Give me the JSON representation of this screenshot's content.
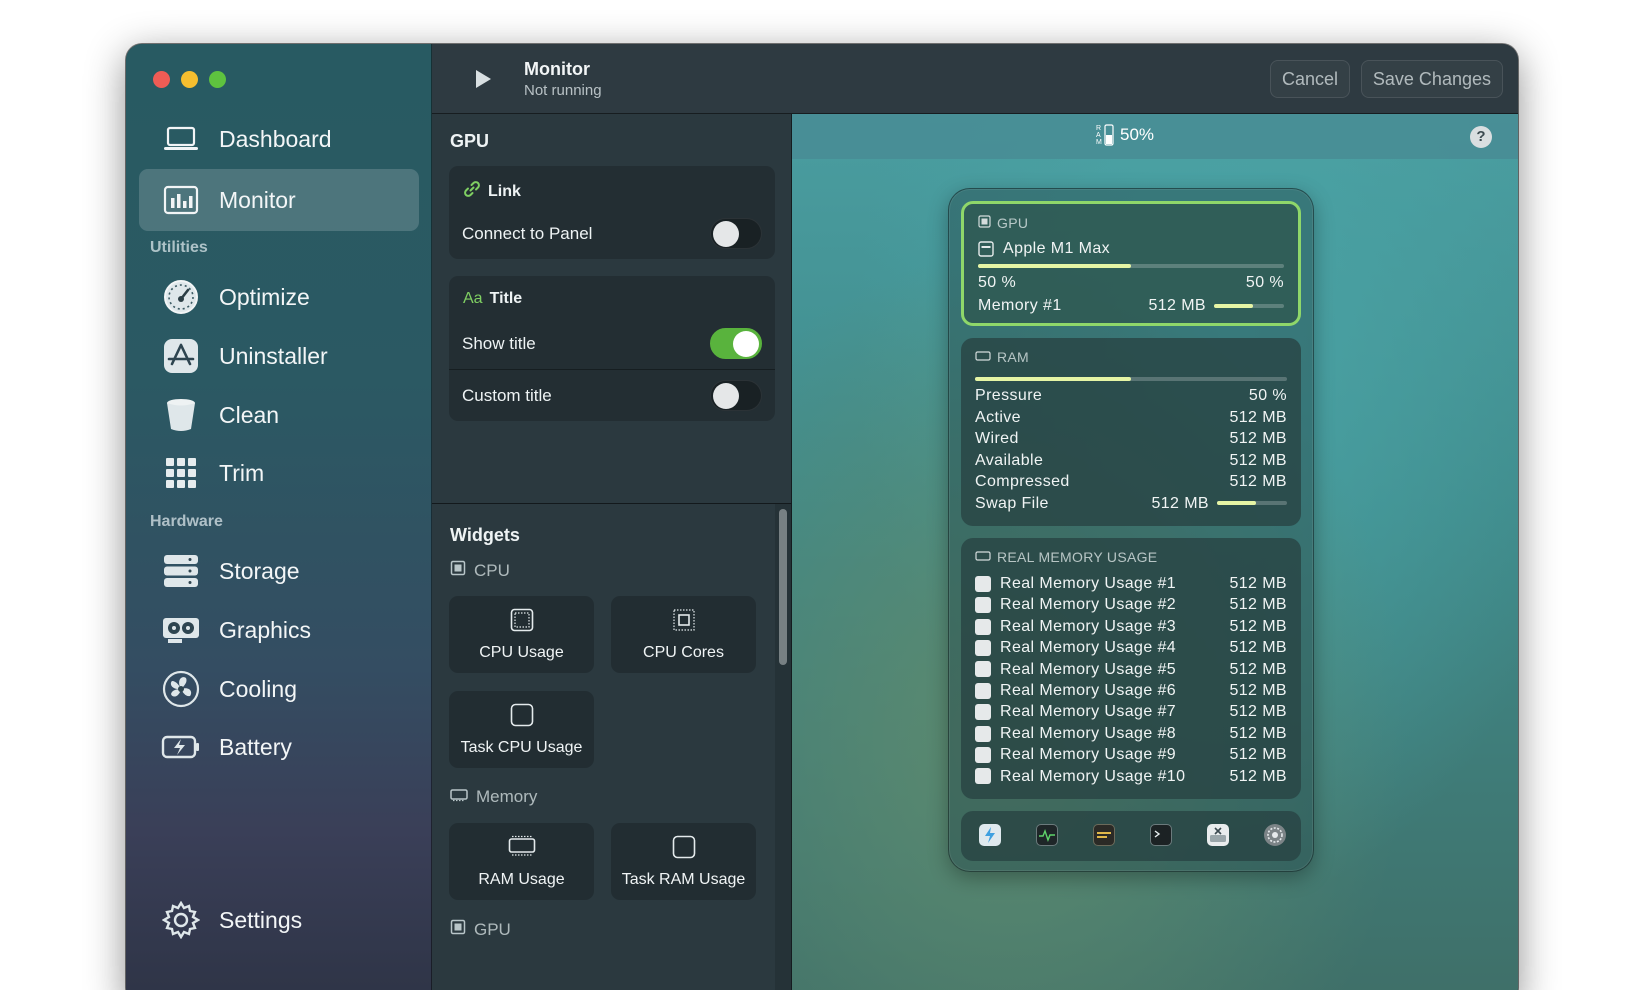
{
  "window": {
    "traffic_lights": [
      "close",
      "minimize",
      "zoom"
    ]
  },
  "sidebar": {
    "items": [
      {
        "label": "Dashboard",
        "icon": "laptop-icon"
      },
      {
        "label": "Monitor",
        "icon": "bar-chart-icon",
        "active": true
      }
    ],
    "utilities_label": "Utilities",
    "utilities": [
      {
        "label": "Optimize",
        "icon": "gauge-icon"
      },
      {
        "label": "Uninstaller",
        "icon": "app-store-icon"
      },
      {
        "label": "Clean",
        "icon": "trash-bin-icon"
      },
      {
        "label": "Trim",
        "icon": "grid-icon"
      }
    ],
    "hardware_label": "Hardware",
    "hardware": [
      {
        "label": "Storage",
        "icon": "storage-icon"
      },
      {
        "label": "Graphics",
        "icon": "graphics-card-icon"
      },
      {
        "label": "Cooling",
        "icon": "fan-icon"
      },
      {
        "label": "Battery",
        "icon": "battery-icon"
      }
    ],
    "settings_label": "Settings"
  },
  "topbar": {
    "title": "Monitor",
    "subtitle": "Not running",
    "cancel_label": "Cancel",
    "save_label": "Save Changes"
  },
  "config": {
    "heading": "GPU",
    "link": {
      "header": "Link",
      "connect_label": "Connect to Panel",
      "connect_on": false
    },
    "title_card": {
      "header": "Title",
      "header_prefix": "Aa",
      "show_title_label": "Show title",
      "show_title_on": true,
      "custom_title_label": "Custom title",
      "custom_title_on": false
    }
  },
  "widgets": {
    "heading": "Widgets",
    "cpu_group": "CPU",
    "cpu_tiles": [
      "CPU Usage",
      "CPU Cores",
      "Task CPU Usage"
    ],
    "memory_group": "Memory",
    "memory_tiles": [
      "RAM Usage",
      "Task RAM Usage"
    ],
    "gpu_group": "GPU"
  },
  "preview": {
    "menubar_ram": "50%",
    "menubar_ram_letters": "RAM",
    "help": "?",
    "gpu_card": {
      "header": "GPU",
      "device": "Apple M1 Max",
      "usage_left": "50 %",
      "usage_right": "50 %",
      "usage_fraction": 0.5,
      "memory_label": "Memory #1",
      "memory_value": "512 MB",
      "memory_fraction": 0.55
    },
    "ram_card": {
      "header": "RAM",
      "pressure_fraction": 0.5,
      "rows": [
        {
          "label": "Pressure",
          "value": "50 %"
        },
        {
          "label": "Active",
          "value": "512 MB"
        },
        {
          "label": "Wired",
          "value": "512 MB"
        },
        {
          "label": "Available",
          "value": "512 MB"
        },
        {
          "label": "Compressed",
          "value": "512 MB"
        },
        {
          "label": "Swap File",
          "value": "512 MB"
        }
      ],
      "swap_fraction": 0.55
    },
    "real_memory_card": {
      "header": "REAL MEMORY USAGE",
      "rows": [
        {
          "label": "Real Memory Usage #1",
          "value": "512 MB"
        },
        {
          "label": "Real Memory Usage #2",
          "value": "512 MB"
        },
        {
          "label": "Real Memory Usage #3",
          "value": "512 MB"
        },
        {
          "label": "Real Memory Usage #4",
          "value": "512 MB"
        },
        {
          "label": "Real Memory Usage #5",
          "value": "512 MB"
        },
        {
          "label": "Real Memory Usage #6",
          "value": "512 MB"
        },
        {
          "label": "Real Memory Usage #7",
          "value": "512 MB"
        },
        {
          "label": "Real Memory Usage #8",
          "value": "512 MB"
        },
        {
          "label": "Real Memory Usage #9",
          "value": "512 MB"
        },
        {
          "label": "Real Memory Usage #10",
          "value": "512 MB"
        }
      ]
    },
    "dock_icons": [
      "flash-app-icon",
      "activity-monitor-icon",
      "console-icon",
      "terminal-icon",
      "disk-utility-icon",
      "system-settings-icon"
    ]
  },
  "colors": {
    "accent_green": "#59b33d",
    "selection_border": "#8fd76a",
    "bar_fill": "#e6f5a5"
  }
}
